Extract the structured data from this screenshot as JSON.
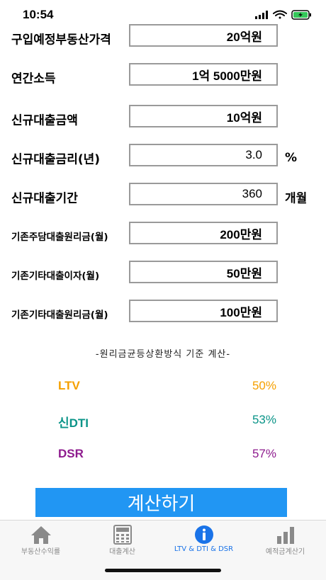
{
  "status": {
    "time": "10:54"
  },
  "fields": [
    {
      "label": "구입예정부동산가격",
      "value": "20억원",
      "unit": ""
    },
    {
      "label": "연간소득",
      "value": "1억 5000만원",
      "unit": ""
    },
    {
      "label": "신규대출금액",
      "value": "10억원",
      "unit": ""
    },
    {
      "label": "신규대출금리(년)",
      "value": "3.0",
      "unit": "%"
    },
    {
      "label": "신규대출기간",
      "value": "360",
      "unit": "개월"
    },
    {
      "label": "기존주담대출원리금(월)",
      "value": "200만원",
      "unit": ""
    },
    {
      "label": "기존기타대출이자(월)",
      "value": "50만원",
      "unit": ""
    },
    {
      "label": "기존기타대출원리금(월)",
      "value": "100만원",
      "unit": ""
    }
  ],
  "note": "-원리금균등상환방식 기준 계산-",
  "results": [
    {
      "label": "LTV",
      "value": "50%",
      "label_color": "#f5a000",
      "value_color": "#f5a000"
    },
    {
      "label": "신DTI",
      "value": "53%",
      "label_color": "#0a9488",
      "value_color": "#0a9488"
    },
    {
      "label": "DSR",
      "value": "57%",
      "label_color": "#8e1b8e",
      "value_color": "#8e1b8e"
    }
  ],
  "calc_button_label": "계산하기",
  "tabs": [
    {
      "label": "부동산수익률",
      "icon": "home-icon",
      "active": false
    },
    {
      "label": "대출계산",
      "icon": "calculator-icon",
      "active": false
    },
    {
      "label": "LTV & DTI & DSR",
      "icon": "info-icon",
      "active": true
    },
    {
      "label": "예적금계산기",
      "icon": "bar-chart-icon",
      "active": false
    }
  ],
  "colors": {
    "accent": "#2196f3",
    "tab_active": "#1a73e8",
    "tab_inactive": "#8a8a8a"
  }
}
